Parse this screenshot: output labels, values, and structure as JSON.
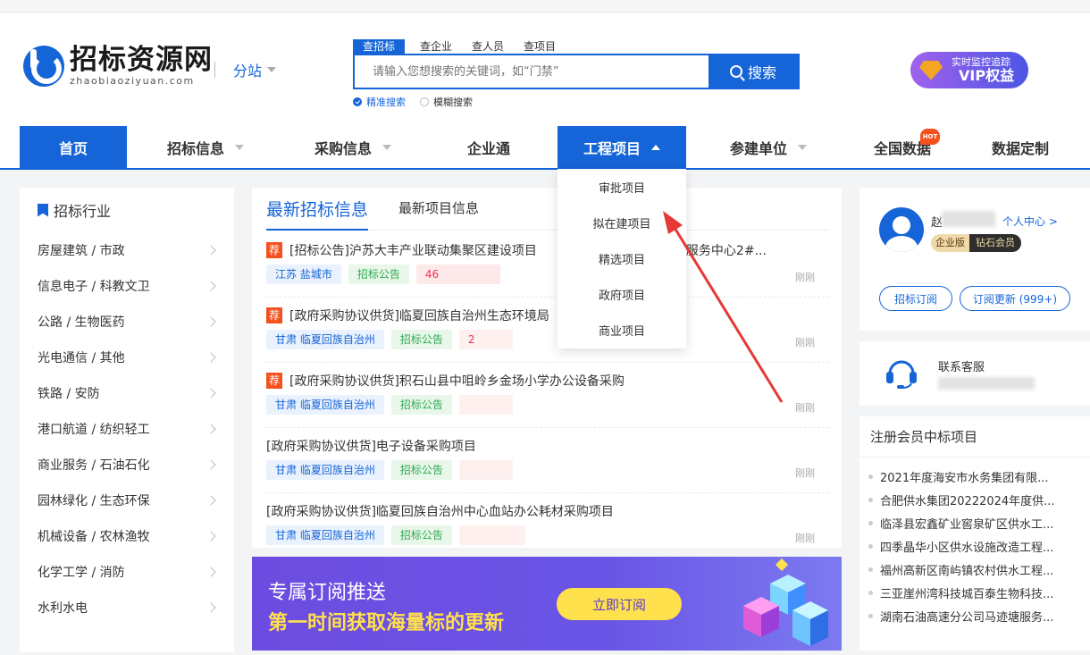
{
  "logo": {
    "cn": "招标资源网",
    "en": "zhaobiaoziyuan.com"
  },
  "substation": "分站",
  "search": {
    "tabs": [
      "查招标",
      "查企业",
      "查人员",
      "查项目"
    ],
    "placeholder": "请输入您想搜索的关键词，如“门禁”",
    "button": "搜索",
    "mode_exact": "精准搜索",
    "mode_fuzzy": "模糊搜索"
  },
  "vip": {
    "line1": "实时监控追踪",
    "line2": "VIP权益"
  },
  "nav": {
    "items": [
      "首页",
      "招标信息",
      "采购信息",
      "企业通",
      "工程项目",
      "参建单位",
      "全国数据",
      "数据定制"
    ],
    "hot_badge": "HOT"
  },
  "dropdown": [
    "审批项目",
    "拟在建项目",
    "精选项目",
    "政府项目",
    "商业项目"
  ],
  "left": {
    "title": "招标行业",
    "items": [
      "房屋建筑 / 市政",
      "信息电子 / 科教文卫",
      "公路 / 生物医药",
      "光电通信 / 其他",
      "铁路 / 安防",
      "港口航道 / 纺织轻工",
      "商业服务 / 石油石化",
      "园林绿化 / 生态环保",
      "机械设备 / 农林渔牧",
      "化学工学 / 消防",
      "水利水电"
    ]
  },
  "main": {
    "tabs": [
      "最新招标信息",
      "最新项目信息"
    ],
    "rows": [
      {
        "rec": "荐",
        "title": "[招标公告]沪苏大丰产业联动集聚区建设项目",
        "title_tail": "区产业服务中心2#...",
        "loc": "江苏 盐城市",
        "type": "招标公告",
        "amount": "46",
        "time": "刚刚"
      },
      {
        "rec": "荐",
        "title": "[政府采购协议供货]临夏回族自治州生态环境局",
        "loc": "甘肃 临夏回族自治州",
        "type": "招标公告",
        "amount": "2",
        "time": "刚刚"
      },
      {
        "rec": "荐",
        "title": "[政府采购协议供货]积石山县中咀岭乡金场小学办公设备采购",
        "loc": "甘肃 临夏回族自治州",
        "type": "招标公告",
        "amount": "",
        "time": "刚刚"
      },
      {
        "rec": "",
        "title": "[政府采购协议供货]电子设备采购项目",
        "loc": "甘肃 临夏回族自治州",
        "type": "招标公告",
        "amount": "",
        "time": "刚刚"
      },
      {
        "rec": "",
        "title": "[政府采购协议供货]临夏回族自治州中心血站办公耗材采购项目",
        "loc": "甘肃 临夏回族自治州",
        "type": "招标公告",
        "amount": "",
        "time": "刚刚"
      }
    ]
  },
  "banner": {
    "line1": "专属订阅推送",
    "line2": "第一时间获取海量标的更新",
    "button": "立即订阅"
  },
  "user": {
    "name_initial": "赵",
    "center_link": "个人中心 >",
    "badge1": "企业版",
    "badge2": "钻石会员",
    "btn_subscribe": "招标订阅",
    "btn_updates": "订阅更新 (999+)"
  },
  "service": {
    "label": "联系客服"
  },
  "winners": {
    "title": "注册会员中标项目",
    "items": [
      "2021年度海安市水务集团有限...",
      "合肥供水集团20222024年度供...",
      "临泽县宏鑫矿业窖泉矿区供水工...",
      "四季晶华小区供水设施改造工程...",
      "福州高新区南屿镇农村供水工程...",
      "三亚崖州湾科技城百泰生物科技...",
      "湖南石油高速分公司马迹塘服务..."
    ]
  },
  "colors": {
    "primary": "#1565d8",
    "hot": "#f4511e",
    "arrow": "#e53935",
    "banner_yellow": "#ffe04d"
  }
}
